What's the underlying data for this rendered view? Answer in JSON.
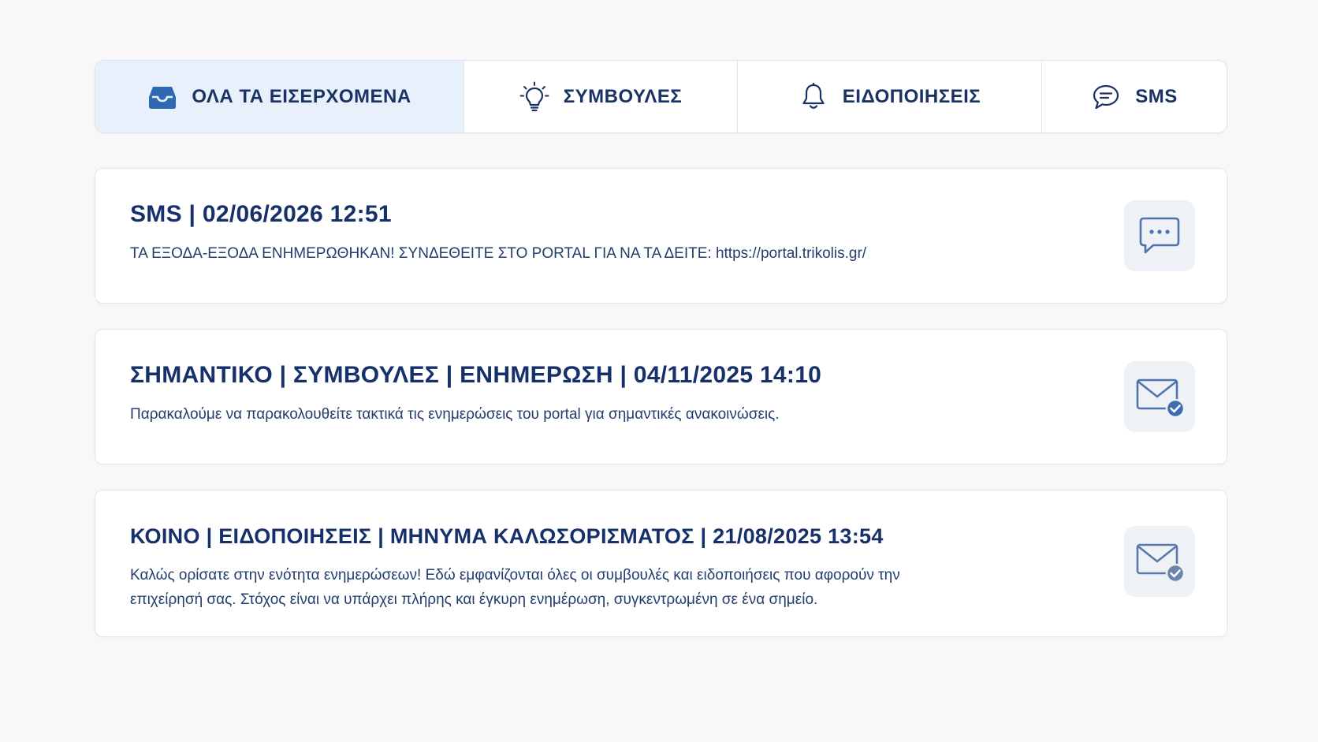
{
  "tabs": [
    {
      "label": "ΟΛΑ ΤΑ ΕΙΣΕΡΧΟΜΕΝΑ",
      "icon": "inbox-icon",
      "active": true
    },
    {
      "label": "ΣΥΜΒΟΥΛΕΣ",
      "icon": "lightbulb-icon",
      "active": false
    },
    {
      "label": "ΕΙΔΟΠΟΙΗΣΕΙΣ",
      "icon": "bell-icon",
      "active": false
    },
    {
      "label": "SMS",
      "icon": "chat-icon",
      "active": false
    }
  ],
  "messages": [
    {
      "title": "SMS | 02/06/2026 12:51",
      "body": "ΤΑ ΕΞΟΔΑ-ΕΞΟΔΑ ΕΝΗΜΕΡΩΘΗΚΑΝ! ΣΥΝΔΕΘΕΙΤΕ ΣΤΟ PORTAL ΓΙΑ ΝΑ ΤΑ ΔΕΙΤΕ: https://portal.trikolis.gr/",
      "icon": "sms-bubble-icon"
    },
    {
      "title": "ΣΗΜΑΝΤΙΚΟ | ΣΥΜΒΟΥΛΕΣ | ΕΝΗΜΕΡΩΣΗ | 04/11/2025 14:10",
      "body": "Παρακαλούμε να παρακολουθείτε τακτικά τις ενημερώσεις του portal για σημαντικές ανακοινώσεις.",
      "icon": "envelope-check-icon"
    },
    {
      "title": "ΚΟΙΝΟ | ΕΙΔΟΠΟΙΗΣΕΙΣ | ΜΗΝΥΜΑ ΚΑΛΩΣΟΡΙΣΜΑΤΟΣ | 21/08/2025 13:54",
      "body": "Καλώς ορίσατε στην ενότητα ενημερώσεων! Εδώ εμφανίζονται όλες οι συμβουλές και ειδοποιήσεις που αφορούν την επιχείρησή σας. Στόχος είναι να υπάρχει πλήρης και έγκυρη ενημέρωση, συγκεντρωμένη σε ένα σημείο.",
      "icon": "envelope-check-icon"
    }
  ],
  "colors": {
    "accent": "#2f69b1",
    "title": "#15306a",
    "active_tab_bg": "#e8f1fb"
  }
}
